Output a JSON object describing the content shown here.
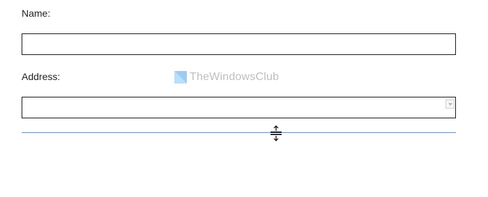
{
  "form": {
    "name_label": "Name:",
    "name_value": "",
    "address_label": "Address:",
    "address_value": ""
  },
  "watermark": {
    "text": "TheWindowsClub",
    "icon": "windows-logo-icon"
  },
  "cursor": {
    "icon": "row-resize-cursor-icon"
  },
  "colors": {
    "splitter": "#6a8bb7",
    "field_border": "#1a1a1a",
    "watermark_logo": "#2f8fdf"
  }
}
